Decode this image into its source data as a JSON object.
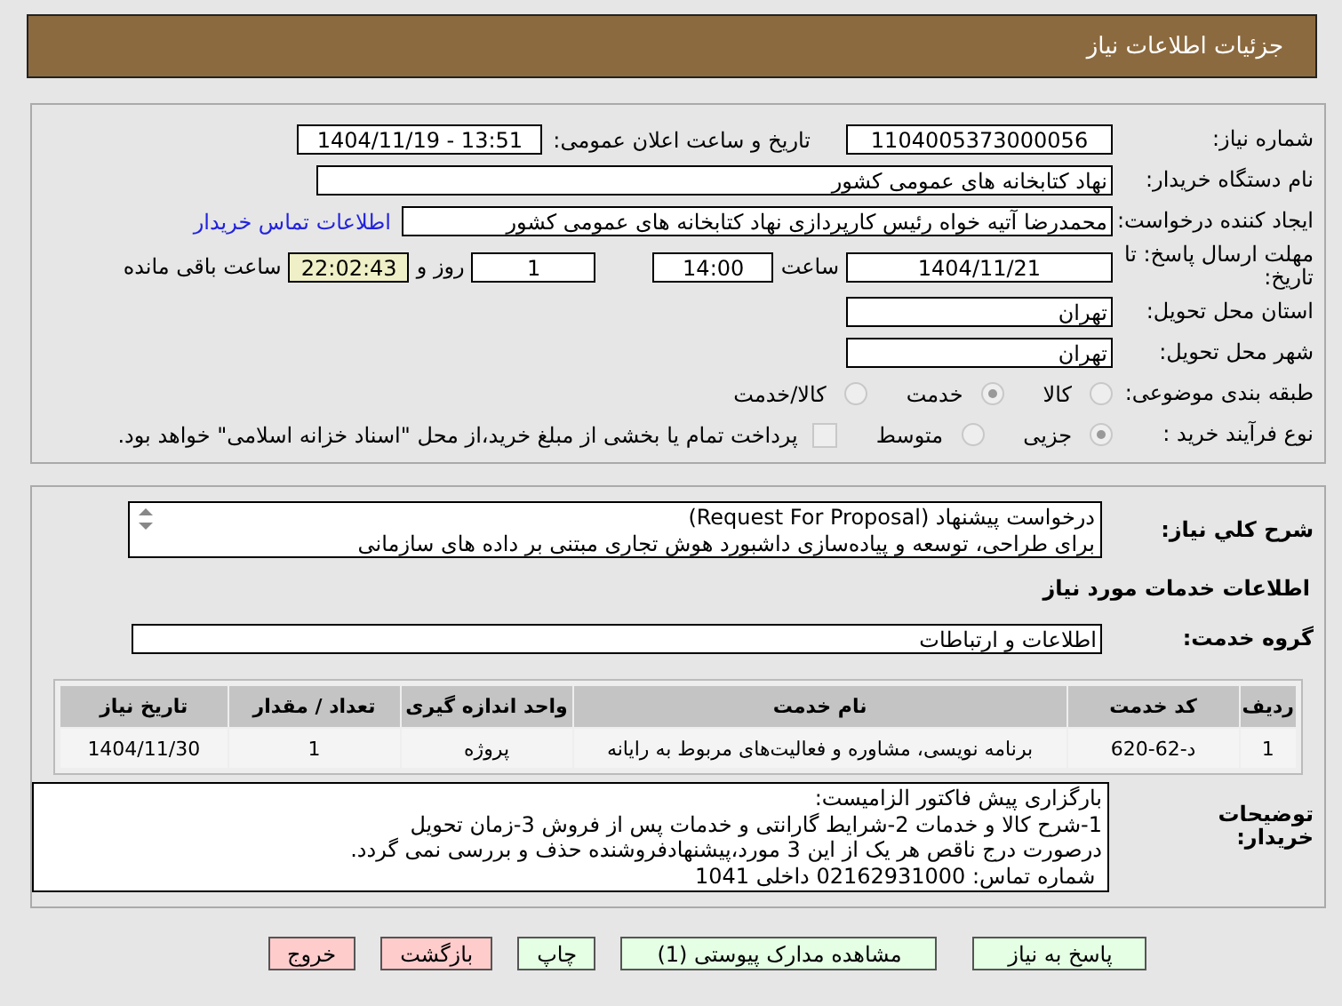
{
  "header": {
    "title": "جزئیات اطلاعات نیاز"
  },
  "need_number": {
    "label": "شماره نیاز:",
    "value": "1104005373000056"
  },
  "announce": {
    "label": "تاریخ و ساعت اعلان عمومی:",
    "value": "1404/11/19 - 13:51"
  },
  "buyer": {
    "label": "نام دستگاه خریدار:",
    "value": "نهاد کتابخانه های عمومی کشور"
  },
  "requester": {
    "label": "ایجاد کننده درخواست:",
    "value": "محمدرضا آتیه خواه  رئیس کارپردازی نهاد کتابخانه های عمومی کشور",
    "link": "اطلاعات تماس خریدار"
  },
  "deadline": {
    "label": "مهلت ارسال پاسخ: تا تاریخ:",
    "date": "1404/11/21",
    "time_label": "ساعت",
    "time": "14:00",
    "days": "1",
    "days_label": "روز و",
    "remaining": "22:02:43",
    "remaining_label": "ساعت باقی مانده"
  },
  "province": {
    "label": "استان محل تحویل:",
    "value": "تهران"
  },
  "city": {
    "label": "شهر محل تحویل:",
    "value": "تهران"
  },
  "category": {
    "label": "طبقه بندی موضوعی:",
    "options": [
      {
        "label": "کالا",
        "selected": false
      },
      {
        "label": "خدمت",
        "selected": true
      },
      {
        "label": "کالا/خدمت",
        "selected": false
      }
    ]
  },
  "process": {
    "label": "نوع فرآیند خرید :",
    "options": [
      {
        "label": "جزیی",
        "selected": true
      },
      {
        "label": "متوسط",
        "selected": false
      }
    ],
    "payment": {
      "checked": false,
      "text": "پرداخت تمام یا بخشی از مبلغ خرید،از محل \"اسناد خزانه اسلامی\" خواهد بود."
    }
  },
  "description": {
    "label": "شرح کلي نیاز:",
    "lines": [
      "درخواست پیشنهاد (Request For Proposal)",
      "برای طراحی، توسعه و پیاده‌سازی داشبورد هوش تجاری مبتنی بر داده های سازمانی"
    ]
  },
  "services_heading": "اطلاعات خدمات مورد نیاز",
  "service_group": {
    "label": "گروه خدمت:",
    "value": "اطلاعات و ارتباطات"
  },
  "table": {
    "columns": [
      "ردیف",
      "کد خدمت",
      "نام خدمت",
      "واحد اندازه گیری",
      "تعداد / مقدار",
      "تاریخ نیاز"
    ],
    "rows": [
      [
        "1",
        "د-62-620",
        "برنامه نویسی، مشاوره و فعالیت‌های مربوط به رایانه",
        "پروژه",
        "1",
        "1404/11/30"
      ]
    ]
  },
  "notes": {
    "label": "توضیحات خریدار:",
    "lines": [
      "بارگزاری پیش فاکتور الزامیست:",
      "1-شرح کالا و خدمات 2-شرایط گارانتی و خدمات پس از فروش 3-زمان تحویل",
      "درصورت درج ناقص هر یک از این 3 مورد،پیشنهادفروشنده حذف و بررسی نمی گردد.",
      " شماره تماس: 02162931000 داخلی 1041"
    ]
  },
  "buttons": [
    {
      "label": "پاسخ به نیاز",
      "kind": "primary"
    },
    {
      "label": "مشاهده مدارک پیوستی (1)",
      "kind": "primary"
    },
    {
      "label": "چاپ",
      "kind": "primary"
    },
    {
      "label": "بازگشت",
      "kind": "danger"
    },
    {
      "label": "خروج",
      "kind": "danger"
    }
  ]
}
